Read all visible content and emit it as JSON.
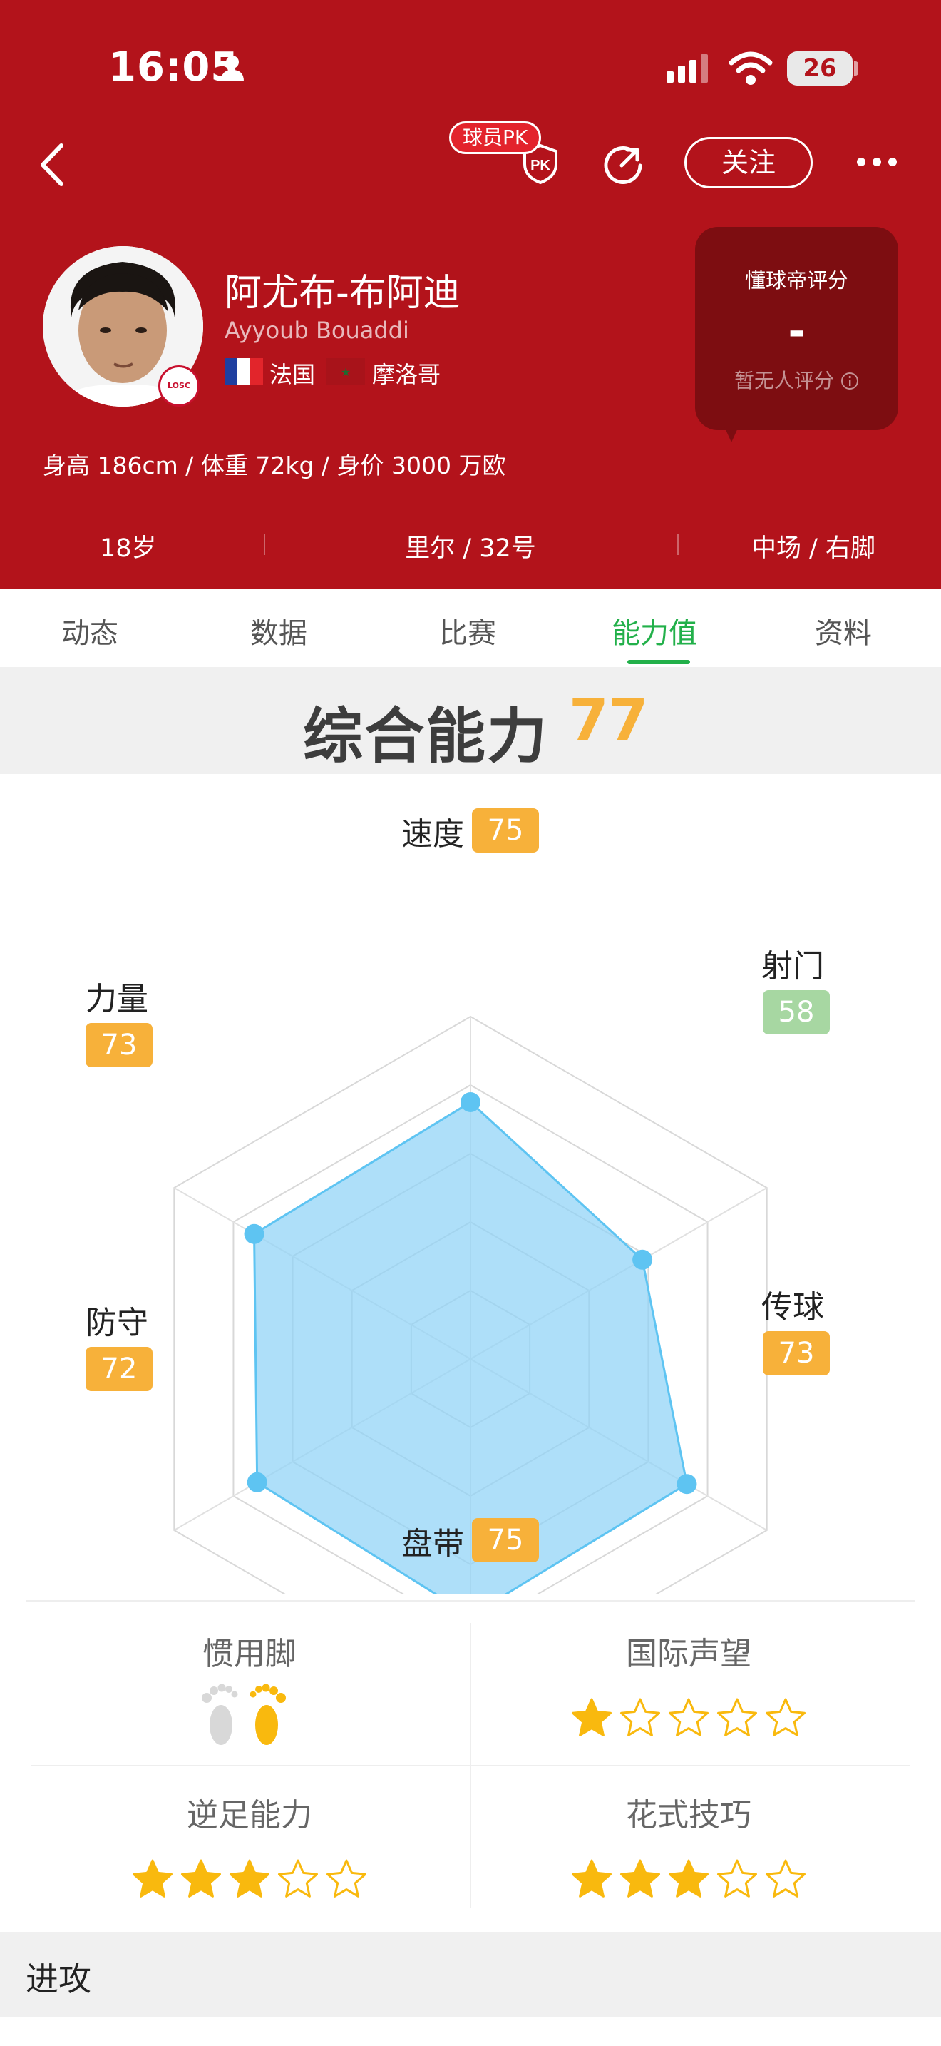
{
  "status_bar": {
    "time": "16:05",
    "battery": "26"
  },
  "header": {
    "pk_label": "球员PK",
    "follow_label": "关注",
    "player": {
      "name_cn": "阿尤布-布阿迪",
      "name_en": "Ayyoub Bouaddi",
      "nations": [
        "法国",
        "摩洛哥"
      ],
      "body_info": "身高 186cm / 体重 72kg / 身价 3000 万欧",
      "club_badge": "LOSC"
    },
    "rating": {
      "title": "懂球帝评分",
      "value": "-",
      "note": "暂无人评分"
    },
    "meta": {
      "age": "18岁",
      "club_number": "里尔 / 32号",
      "position_foot": "中场 / 右脚"
    }
  },
  "tabs": [
    {
      "label": "动态",
      "active": false
    },
    {
      "label": "数据",
      "active": false
    },
    {
      "label": "比赛",
      "active": false
    },
    {
      "label": "能力值",
      "active": true
    },
    {
      "label": "资料",
      "active": false
    }
  ],
  "overall": {
    "title": "综合能力",
    "value": "77"
  },
  "attributes": [
    {
      "label": "速度",
      "value": 75
    },
    {
      "label": "射门",
      "value": 58
    },
    {
      "label": "传球",
      "value": 73
    },
    {
      "label": "盘带",
      "value": 75
    },
    {
      "label": "防守",
      "value": 72
    },
    {
      "label": "力量",
      "value": 73
    }
  ],
  "extra": {
    "preferred_foot": {
      "title": "惯用脚",
      "foot": "right"
    },
    "reputation": {
      "title": "国际声望",
      "stars": 1,
      "max": 5
    },
    "weak_foot": {
      "title": "逆足能力",
      "stars": 3,
      "max": 5
    },
    "skill_moves": {
      "title": "花式技巧",
      "stars": 3,
      "max": 5
    }
  },
  "section_next": "进攻",
  "colors": {
    "header_bg": "#b3131b",
    "accent_green": "#22b04a",
    "badge_orange": "#f7b13a",
    "badge_green": "#a7d7a2",
    "radar_fill": "#8fd3f7",
    "star": "#f9b90e"
  }
}
